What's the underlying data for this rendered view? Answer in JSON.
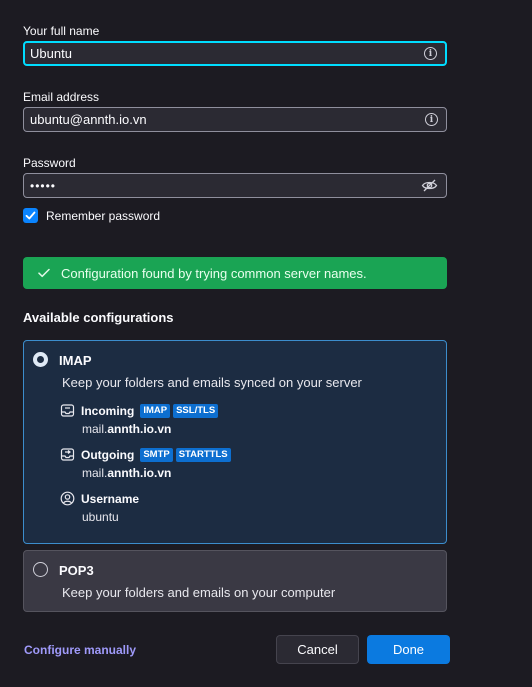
{
  "form": {
    "name_label": "Your full name",
    "name_value": "Ubuntu",
    "email_label": "Email address",
    "email_value": "ubuntu@annth.io.vn",
    "password_label": "Password",
    "password_value": "•••••",
    "remember_label": "Remember password",
    "remember_checked": true
  },
  "status": {
    "message": "Configuration found by trying common server names.",
    "color": "#1aa454"
  },
  "configs": {
    "title": "Available configurations",
    "imap": {
      "name": "IMAP",
      "description": "Keep your folders and emails synced on your server",
      "selected": true,
      "incoming_label": "Incoming",
      "incoming_tags": [
        "IMAP",
        "SSL/TLS"
      ],
      "incoming_host_prefix": "mail.",
      "incoming_host_domain": "annth.io.vn",
      "outgoing_label": "Outgoing",
      "outgoing_tags": [
        "SMTP",
        "STARTTLS"
      ],
      "outgoing_host_prefix": "mail.",
      "outgoing_host_domain": "annth.io.vn",
      "username_label": "Username",
      "username_value": "ubuntu"
    },
    "pop3": {
      "name": "POP3",
      "description": "Keep your folders and emails on your computer",
      "selected": false
    }
  },
  "footer": {
    "configure_manually": "Configure manually",
    "cancel": "Cancel",
    "done": "Done"
  },
  "colors": {
    "accent": "#0a84ff",
    "focus": "#00ddff",
    "tag": "#0d6fd0",
    "link": "#9f9afa"
  },
  "icons": {
    "info": "info-circle-icon",
    "password_toggle": "eye-slash-icon",
    "check": "checkmark-icon",
    "incoming": "inbox-download-icon",
    "outgoing": "outbox-upload-icon",
    "user": "user-icon"
  }
}
